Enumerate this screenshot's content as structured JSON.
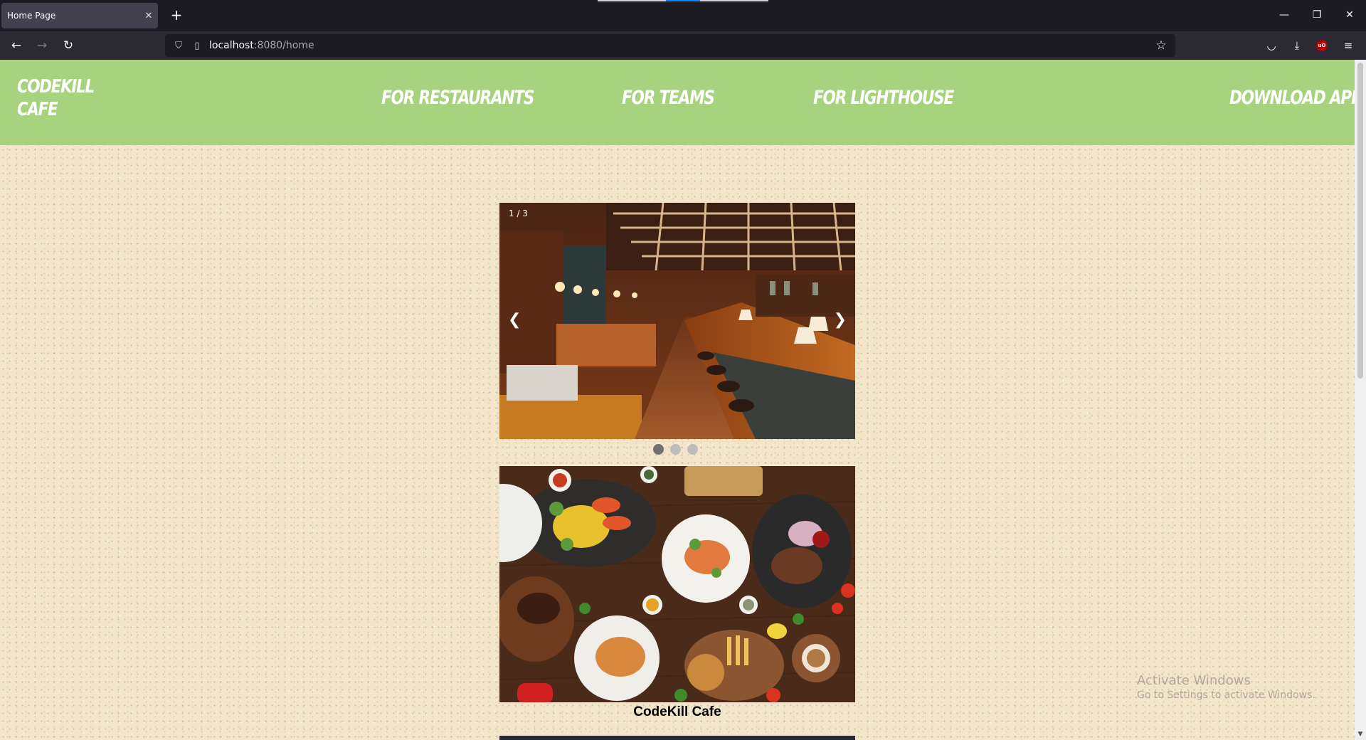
{
  "browser": {
    "tab_title": "Home Page",
    "tab_close": "✕",
    "new_tab": "+",
    "url_host": "localhost",
    "url_path": ":8080/home",
    "window_controls": {
      "minimize": "—",
      "restore": "❐",
      "close": "✕"
    },
    "icons": [
      "back-arrow-icon",
      "forward-arrow-icon",
      "reload-icon",
      "shield-icon",
      "page-icon",
      "star-icon",
      "pocket-icon",
      "download-icon",
      "ublock-icon",
      "menu-icon"
    ]
  },
  "site": {
    "brand": "CodeKill Cafe",
    "nav": [
      "For Restaurants",
      "For Teams",
      "For Lighthouse",
      "Download App"
    ]
  },
  "carousel": {
    "counter": "1 / 3",
    "prev": "❮",
    "next": "❯",
    "total_slides": 3,
    "active_slide": 1
  },
  "card": {
    "caption": "CodeKill Cafe"
  },
  "os_watermark": {
    "line1": "Activate Windows",
    "line2": "Go to Settings to activate Windows."
  }
}
